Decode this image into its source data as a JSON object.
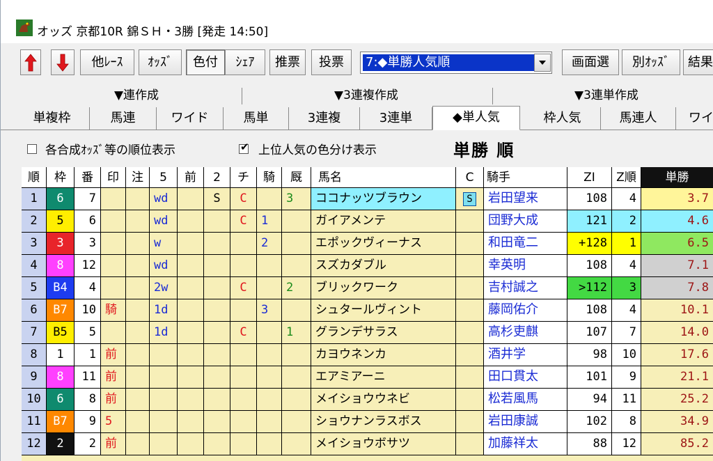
{
  "window": {
    "title": "オッズ 京都10R 錦ＳＨ・3勝 [発走 14:50]"
  },
  "toolbar": {
    "other_race": "他ﾚｰｽ",
    "odds": "ｵｯｽﾞ",
    "color": "色付",
    "share": "ｼｪｱ",
    "recommend": "推票",
    "vote": "投票",
    "dropdown_value": "7:◆単勝人気順",
    "screen_select": "画面選",
    "other_odds": "別ｵｯｽﾞ",
    "result": "結果"
  },
  "groups": [
    "▼連作成",
    "▼3連複作成",
    "▼3連単作成"
  ],
  "tabs": [
    "単複枠",
    "馬連",
    "ワイド",
    "馬単",
    "3連複",
    "3連単",
    "◆単人気",
    "枠人気",
    "馬連人",
    "ワイ"
  ],
  "options": {
    "synthetic_rank": "各合成ｵｯｽﾞ等の順位表示",
    "top_color": "上位人気の色分け表示",
    "heading": "単勝 順",
    "check": "✔"
  },
  "columns": [
    "順",
    "枠",
    "番",
    "印",
    "注",
    "5",
    "前",
    "2",
    "チ",
    "騎",
    "厩",
    "馬名",
    "C",
    "騎手",
    "ZI",
    "Z順",
    "単勝"
  ],
  "rows": [
    {
      "rank": "1",
      "waku": "6",
      "ban": "7",
      "shirushi": "",
      "chu": "",
      "five": "wd",
      "mae": "",
      "two": "S",
      "chi": "C",
      "ki": "",
      "kyu": "3",
      "horse": "ココナッツブラウン",
      "c": "S",
      "jockey": "岩田望来",
      "zi": "108",
      "zrank": "4",
      "odds": "3.7"
    },
    {
      "rank": "2",
      "waku": "5",
      "ban": "6",
      "shirushi": "",
      "chu": "",
      "five": "wd",
      "mae": "",
      "two": "",
      "chi": "C",
      "ki": "1",
      "kyu": "",
      "horse": "ガイアメンテ",
      "c": "",
      "jockey": "団野大成",
      "zi": "121",
      "zrank": "2",
      "odds": "4.6"
    },
    {
      "rank": "3",
      "waku": "3",
      "ban": "3",
      "shirushi": "",
      "chu": "",
      "five": "w",
      "mae": "",
      "two": "",
      "chi": "",
      "ki": "2",
      "kyu": "",
      "horse": "エポックヴィーナス",
      "c": "",
      "jockey": "和田竜二",
      "zi": "+128",
      "zrank": "1",
      "odds": "6.5"
    },
    {
      "rank": "4",
      "waku": "8",
      "ban": "12",
      "shirushi": "",
      "chu": "",
      "five": "wd",
      "mae": "",
      "two": "",
      "chi": "",
      "ki": "",
      "kyu": "",
      "horse": "スズカダブル",
      "c": "",
      "jockey": "幸英明",
      "zi": "108",
      "zrank": "4",
      "odds": "7.1"
    },
    {
      "rank": "5",
      "waku": "B4",
      "ban": "4",
      "shirushi": "",
      "chu": "",
      "five": "2w",
      "mae": "",
      "two": "",
      "chi": "C",
      "ki": "",
      "kyu": "2",
      "horse": "ブリックワーク",
      "c": "",
      "jockey": "吉村誠之",
      "zi": ">112",
      "zrank": "3",
      "odds": "7.8"
    },
    {
      "rank": "6",
      "waku": "B7",
      "ban": "10",
      "shirushi": "騎",
      "chu": "",
      "five": "1d",
      "mae": "",
      "two": "",
      "chi": "",
      "ki": "3",
      "kyu": "",
      "horse": "シュタールヴィント",
      "c": "",
      "jockey": "藤岡佑介",
      "zi": "108",
      "zrank": "4",
      "odds": "10.1"
    },
    {
      "rank": "7",
      "waku": "B5",
      "ban": "5",
      "shirushi": "",
      "chu": "",
      "five": "1d",
      "mae": "",
      "two": "",
      "chi": "C",
      "ki": "",
      "kyu": "1",
      "horse": "グランデサラス",
      "c": "",
      "jockey": "高杉吏麒",
      "zi": "107",
      "zrank": "7",
      "odds": "14.0"
    },
    {
      "rank": "8",
      "waku": "1",
      "ban": "1",
      "shirushi": "前",
      "chu": "",
      "five": "",
      "mae": "",
      "two": "",
      "chi": "",
      "ki": "",
      "kyu": "",
      "horse": "カヨウネンカ",
      "c": "",
      "jockey": "酒井学",
      "zi": "98",
      "zrank": "10",
      "odds": "17.6"
    },
    {
      "rank": "9",
      "waku": "8",
      "ban": "11",
      "shirushi": "前",
      "chu": "",
      "five": "",
      "mae": "",
      "two": "",
      "chi": "",
      "ki": "",
      "kyu": "",
      "horse": "エアミアーニ",
      "c": "",
      "jockey": "田口貫太",
      "zi": "101",
      "zrank": "9",
      "odds": "21.1"
    },
    {
      "rank": "10",
      "waku": "6",
      "ban": "8",
      "shirushi": "前",
      "chu": "",
      "five": "",
      "mae": "",
      "two": "",
      "chi": "",
      "ki": "",
      "kyu": "",
      "horse": "メイショウウネビ",
      "c": "",
      "jockey": "松若風馬",
      "zi": "94",
      "zrank": "11",
      "odds": "25.2"
    },
    {
      "rank": "11",
      "waku": "B7",
      "ban": "9",
      "shirushi": "5",
      "chu": "",
      "five": "",
      "mae": "",
      "two": "",
      "chi": "",
      "ki": "",
      "kyu": "",
      "horse": "ショウナンラスボス",
      "c": "",
      "jockey": "岩田康誠",
      "zi": "102",
      "zrank": "8",
      "odds": "34.9"
    },
    {
      "rank": "12",
      "waku": "2",
      "ban": "2",
      "shirushi": "前",
      "chu": "",
      "five": "",
      "mae": "",
      "two": "",
      "chi": "",
      "ki": "",
      "kyu": "",
      "horse": "メイショウボサツ",
      "c": "",
      "jockey": "加藤祥太",
      "zi": "88",
      "zrank": "12",
      "odds": "85.2"
    }
  ],
  "colors": {
    "waku": {
      "1": "#ffffff",
      "2": "#111111",
      "3": "#e8242a",
      "5": "#ffee00",
      "6": "#0f8a6e",
      "8": "#ff40ff",
      "B4": "#1e3cf0",
      "B5": "#ffee00",
      "B7": "#ff8800"
    },
    "waku_text": {
      "1": "#000000",
      "2": "#ffffff",
      "3": "#ffffff",
      "5": "#000000",
      "6": "#ffffff",
      "8": "#ffffff",
      "B4": "#ffffff",
      "B5": "#000000",
      "B7": "#ffffff"
    },
    "horse_highlight": "#8ff0ff",
    "odds_bg": [
      "#fff59a",
      "#8ff0ff",
      "#8fe860",
      "#d0d0d0",
      "#d0d0d0"
    ],
    "zi_bg": {
      "1": "#8ff0ff",
      "2": "#ffff00",
      "4": "#43d943"
    },
    "odds_text": "#9c1414"
  }
}
